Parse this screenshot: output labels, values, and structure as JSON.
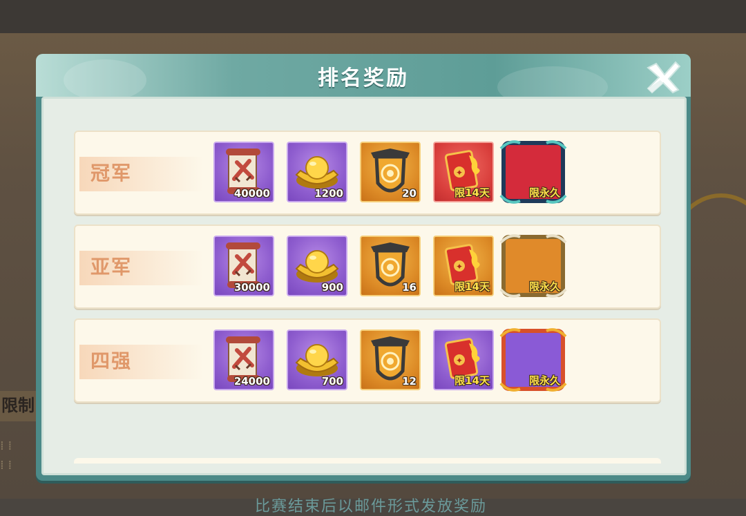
{
  "dialog": {
    "title": "排名奖励",
    "footer": "比赛结束后以邮件形式发放奖励"
  },
  "background": {
    "side_label": "限制"
  },
  "rows": [
    {
      "rank": "冠军",
      "items": [
        {
          "icon": "scroll-icon",
          "qty": "40000",
          "bg": "purple"
        },
        {
          "icon": "gold-ingot-icon",
          "qty": "1200",
          "bg": "purple"
        },
        {
          "icon": "shield-badge-icon",
          "qty": "20",
          "bg": "orange"
        },
        {
          "icon": "red-envelope-card-icon",
          "qty": "限14天",
          "bg": "red"
        },
        {
          "icon": "avatar-frame-icon",
          "qty": "限永久",
          "bg": "red-frame"
        }
      ]
    },
    {
      "rank": "亚军",
      "items": [
        {
          "icon": "scroll-icon",
          "qty": "30000",
          "bg": "purple"
        },
        {
          "icon": "gold-ingot-icon",
          "qty": "900",
          "bg": "purple"
        },
        {
          "icon": "shield-badge-icon",
          "qty": "16",
          "bg": "orange"
        },
        {
          "icon": "red-envelope-card-icon",
          "qty": "限14天",
          "bg": "orange"
        },
        {
          "icon": "avatar-frame-icon",
          "qty": "限永久",
          "bg": "orange-frame"
        }
      ]
    },
    {
      "rank": "四强",
      "items": [
        {
          "icon": "scroll-icon",
          "qty": "24000",
          "bg": "purple"
        },
        {
          "icon": "gold-ingot-icon",
          "qty": "700",
          "bg": "purple"
        },
        {
          "icon": "shield-badge-icon",
          "qty": "12",
          "bg": "orange"
        },
        {
          "icon": "red-envelope-card-icon",
          "qty": "限14天",
          "bg": "purple"
        },
        {
          "icon": "avatar-frame-icon",
          "qty": "限永久",
          "bg": "purple-frame"
        }
      ]
    }
  ],
  "colors": {
    "header": "#5e9d97",
    "panel": "#e6ede6",
    "row": "#fdf8ea",
    "rank_text": "#e0986a",
    "footer_text": "#6b9a9a"
  }
}
